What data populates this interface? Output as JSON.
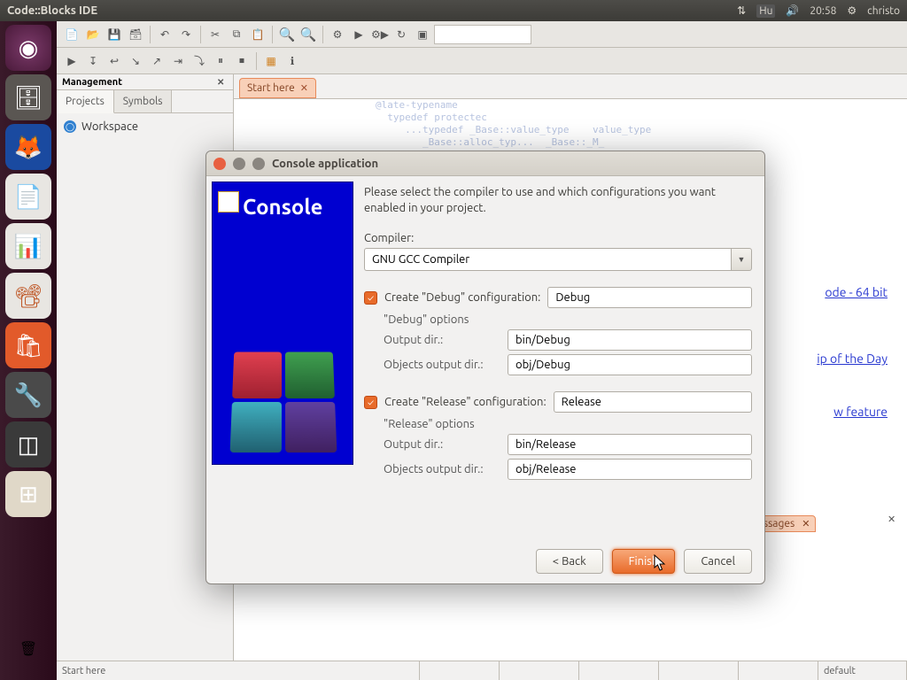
{
  "menubar": {
    "app_title": "Code::Blocks IDE",
    "indicators": {
      "kb": "Hu",
      "time": "20:58",
      "user": "christo"
    }
  },
  "launcher": {
    "items": [
      {
        "name": "dash"
      },
      {
        "name": "files"
      },
      {
        "name": "firefox"
      },
      {
        "name": "writer"
      },
      {
        "name": "calc"
      },
      {
        "name": "impress"
      },
      {
        "name": "software-center"
      },
      {
        "name": "system-settings"
      },
      {
        "name": "codeblocks"
      },
      {
        "name": "workspace-switcher"
      }
    ],
    "trash": "trash"
  },
  "management": {
    "title": "Management",
    "tabs": {
      "projects": "Projects",
      "symbols": "Symbols"
    },
    "tree": {
      "workspace": "Workspace"
    }
  },
  "editor": {
    "tab": {
      "label": "Start here"
    },
    "links": {
      "l1": "ode - 64 bit",
      "l2": "ip of the Day",
      "l3": "w feature "
    }
  },
  "log": {
    "tab": "l messages"
  },
  "status": {
    "left": "Start here",
    "right": "default"
  },
  "dialog": {
    "title": "Console application",
    "banner": "Console",
    "instruction": "Please select the compiler to use and which configurations you want enabled in your project.",
    "compiler_label": "Compiler:",
    "compiler_value": "GNU GCC Compiler",
    "debug": {
      "check_label": "Create \"Debug\" configuration:",
      "name": "Debug",
      "opts_title": "\"Debug\" options",
      "out_label": "Output dir.:",
      "out_value": "bin/Debug",
      "obj_label": "Objects output dir.:",
      "obj_value": "obj/Debug"
    },
    "release": {
      "check_label": "Create \"Release\" configuration:",
      "name": "Release",
      "opts_title": "\"Release\" options",
      "out_label": "Output dir.:",
      "out_value": "bin/Release",
      "obj_label": "Objects output dir.:",
      "obj_value": "obj/Release"
    },
    "buttons": {
      "back": "< Back",
      "finish": "Finish",
      "cancel": "Cancel"
    }
  }
}
